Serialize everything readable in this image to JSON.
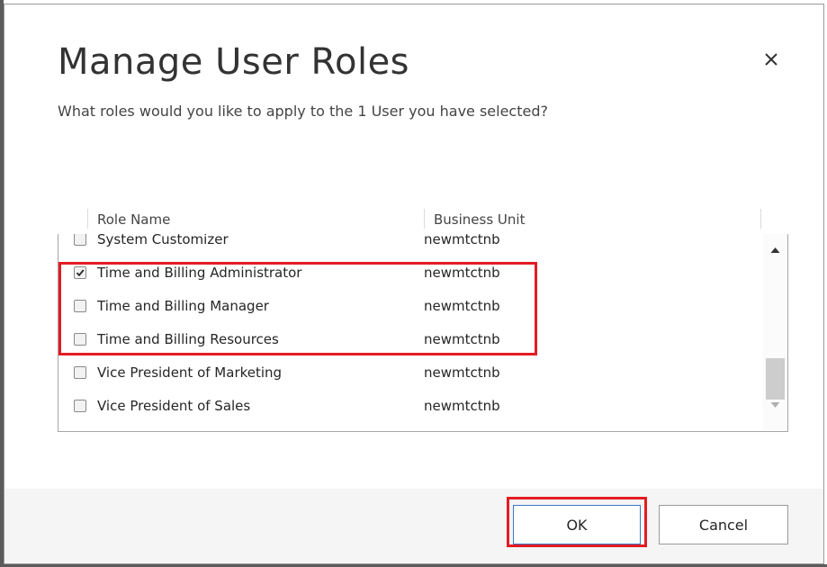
{
  "dialog": {
    "title": "Manage User Roles",
    "subtitle": "What roles would you like to apply to the 1 User you have selected?",
    "close_icon": "close-icon"
  },
  "grid": {
    "columns": [
      "Role Name",
      "Business Unit"
    ],
    "rows": [
      {
        "role": "System Customizer",
        "business_unit": "newmtctnb",
        "checked": false
      },
      {
        "role": "Time and Billing Administrator",
        "business_unit": "newmtctnb",
        "checked": true
      },
      {
        "role": "Time and Billing Manager",
        "business_unit": "newmtctnb",
        "checked": false
      },
      {
        "role": "Time and Billing Resources",
        "business_unit": "newmtctnb",
        "checked": false
      },
      {
        "role": "Vice President of Marketing",
        "business_unit": "newmtctnb",
        "checked": false
      },
      {
        "role": "Vice President of Sales",
        "business_unit": "newmtctnb",
        "checked": false
      }
    ]
  },
  "buttons": {
    "ok": "OK",
    "cancel": "Cancel"
  },
  "colors": {
    "highlight": "#e31c23",
    "ok_border": "#3a78c9"
  }
}
